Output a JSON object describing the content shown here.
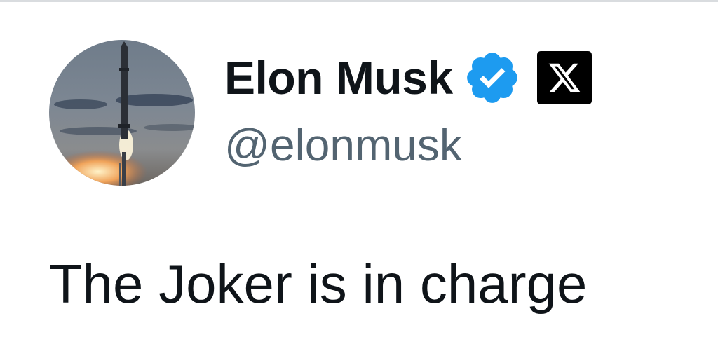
{
  "tweet": {
    "author": {
      "display_name": "Elon Musk",
      "handle": "@elonmusk",
      "verified_icon": "verified-badge-icon",
      "affiliate_icon": "x-logo-icon",
      "avatar_icon": "rocket-launch-avatar"
    },
    "text": "The Joker is in charge"
  },
  "colors": {
    "text_primary": "#0f1419",
    "text_secondary": "#536471",
    "verified_blue": "#1d9bf0",
    "background": "#ffffff"
  }
}
